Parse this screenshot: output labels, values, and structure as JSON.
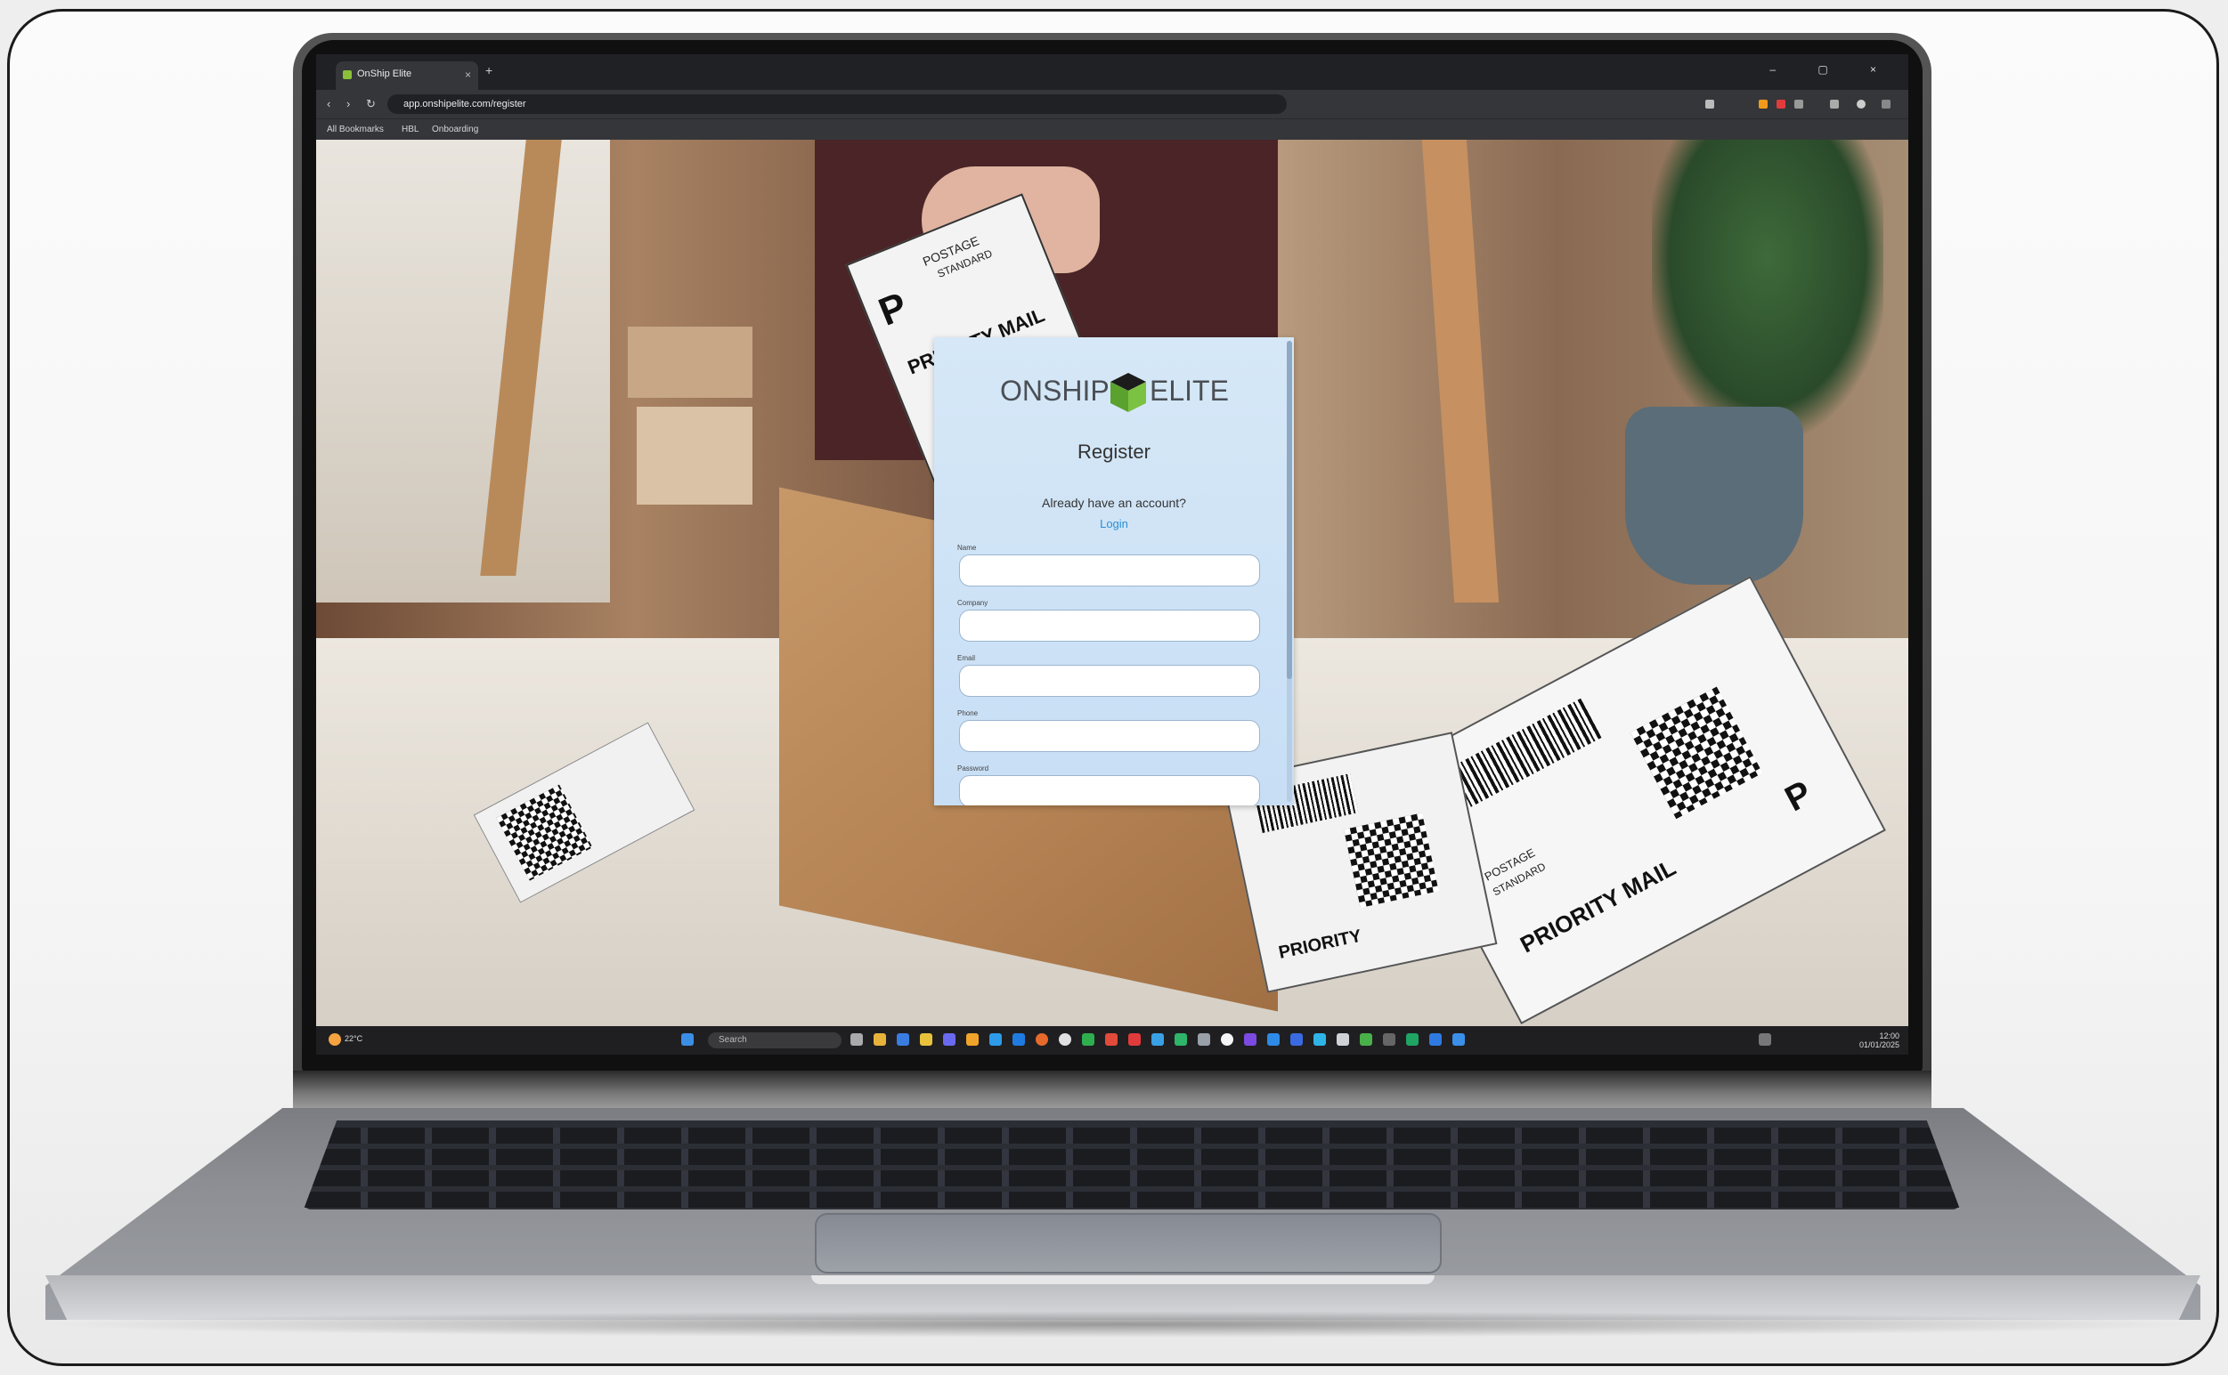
{
  "browser": {
    "tab_title": "OnShip Elite",
    "tab_close": "×",
    "new_tab": "+",
    "window_controls": "– ▢ ×",
    "url": "app.onshipelite.com/register",
    "bookmarks": [
      "All Bookmarks",
      "HBL",
      "Onboarding"
    ],
    "nav": {
      "back": "‹",
      "forward": "›",
      "reload": "↻"
    }
  },
  "register_form": {
    "logo_left": "ONSHIP",
    "logo_right": "ELITE",
    "heading": "Register",
    "already_text": "Already have an account?",
    "login_link": "Login",
    "fields": [
      {
        "label": "Name",
        "value": "",
        "placeholder": ""
      },
      {
        "label": "Company",
        "value": "",
        "placeholder": ""
      },
      {
        "label": "Email",
        "value": "",
        "placeholder": ""
      },
      {
        "label": "Phone",
        "value": "",
        "placeholder": ""
      },
      {
        "label": "Password",
        "value": "",
        "placeholder": ""
      }
    ]
  },
  "background_photo": {
    "label_left": [
      "P",
      "POSTAGE",
      "STANDARD",
      "PRIORITY MAIL"
    ],
    "label_right": [
      "P",
      "PRIORITY MAIL",
      "POSTAGE",
      "STANDARD",
      "PRIORITY"
    ]
  },
  "taskbar": {
    "weather": "22°C",
    "search_placeholder": "Search",
    "time": "12:00",
    "date": "01/01/2025"
  },
  "colors": {
    "card_background": "#c7def5",
    "link": "#2a8fd6",
    "logo_cube_top": "#1c1c1c",
    "logo_cube_side": "#7cc242"
  }
}
